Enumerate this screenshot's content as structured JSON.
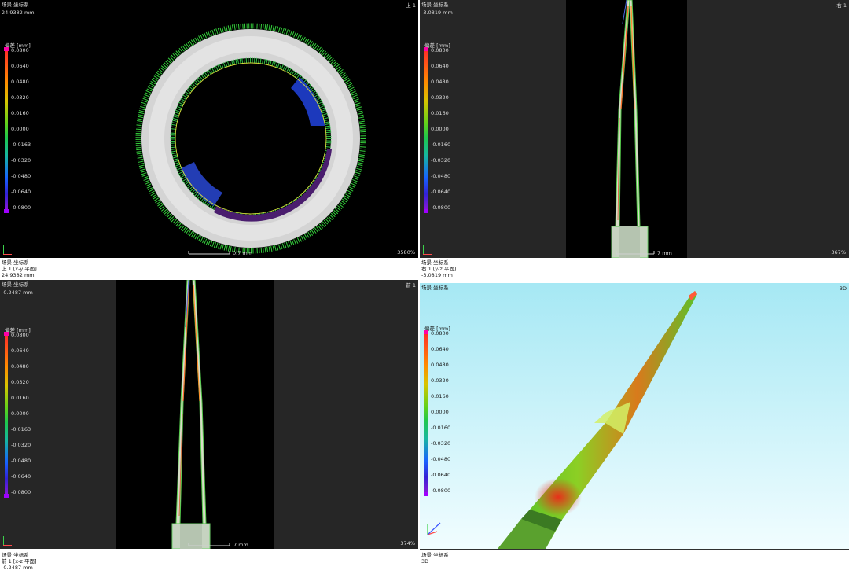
{
  "colors": {
    "accent": "#ff00a8",
    "deviation_max": "#ff2a2a",
    "deviation_zero": "#1ec84d",
    "deviation_min": "#8a18d8"
  },
  "legend": {
    "title": "偏差 [mm]",
    "ticks": [
      "0.0800",
      "0.0640",
      "0.0480",
      "0.0320",
      "0.0160",
      "0.0000",
      "-0.0160",
      "-0.0320",
      "-0.0480",
      "-0.0640",
      "-0.0800"
    ]
  },
  "views": {
    "top": {
      "label": "场景 坐标系",
      "value": "24.9382 mm",
      "corner": "上 1",
      "scale": "0.7 mm",
      "zoom": "3580%",
      "legend_title": "偏差 [mm]",
      "ticks": [
        "0.0800",
        "0.0640",
        "0.0480",
        "0.0320",
        "0.0160",
        "0.0000",
        "-0.0163",
        "-0.0320",
        "-0.0480",
        "-0.0640",
        "-0.0800"
      ],
      "caption": {
        "line1": "场景 坐标系",
        "line2": "上 1  [x-y 平面]",
        "line3": "24.9382 mm"
      }
    },
    "right": {
      "label": "场景 坐标系",
      "value": "-3.0819 mm",
      "corner": "右 1",
      "scale": "7 mm",
      "zoom": "367%",
      "legend_title": "偏差 [mm]",
      "ticks": [
        "0.0800",
        "0.0640",
        "0.0480",
        "0.0320",
        "0.0160",
        "0.0000",
        "-0.0160",
        "-0.0320",
        "-0.0480",
        "-0.0640",
        "-0.0800"
      ],
      "caption": {
        "line1": "场景 坐标系",
        "line2": "右 1  [y-z 平面]",
        "line3": "-3.0819 mm"
      }
    },
    "front": {
      "label": "场景 坐标系",
      "value": "-0.2487 mm",
      "corner": "前 1",
      "scale": "7 mm",
      "zoom": "374%",
      "legend_title": "偏差 [mm]",
      "ticks": [
        "0.0800",
        "0.0640",
        "0.0480",
        "0.0320",
        "0.0160",
        "0.0000",
        "-0.0163",
        "-0.0320",
        "-0.0480",
        "-0.0640",
        "-0.0800"
      ],
      "caption": {
        "line1": "场景 坐标系",
        "line2": "前 1  [x-z 平面]",
        "line3": "-0.2487 mm"
      }
    },
    "iso": {
      "label": "场景 坐标系",
      "corner": "3D",
      "legend_title": "偏差 [mm]",
      "ticks": [
        "0.0800",
        "0.0640",
        "0.0480",
        "0.0320",
        "0.0160",
        "0.0000",
        "-0.0160",
        "-0.0320",
        "-0.0480",
        "-0.0640",
        "-0.0800"
      ],
      "caption": {
        "line1": "场景 坐标系",
        "line2": "3D"
      }
    }
  }
}
